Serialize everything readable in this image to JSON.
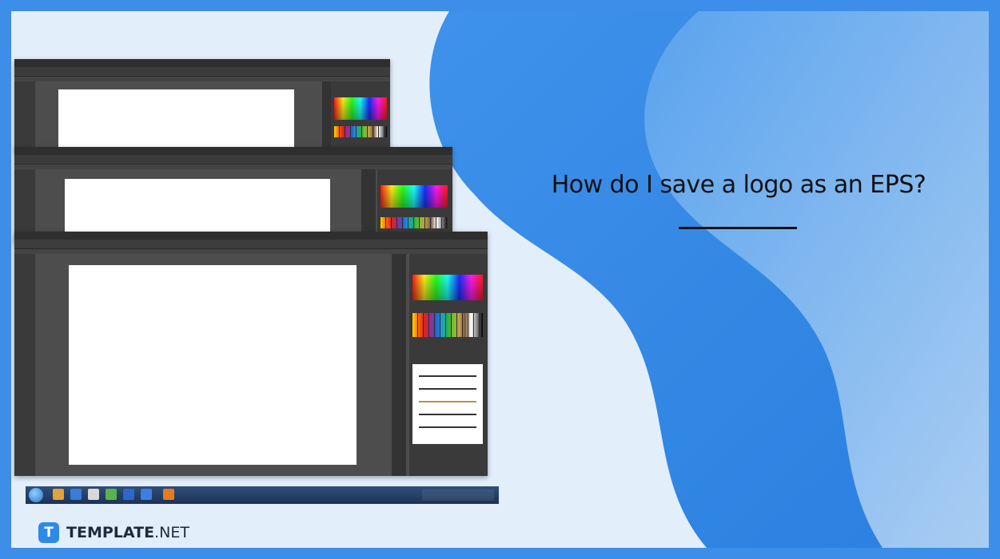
{
  "slide": {
    "title": "How do I save a logo as an EPS?",
    "brand_mark": "T",
    "brand_name_bold": "TEMPLATE",
    "brand_name_light": ".NET"
  },
  "colors": {
    "frame": "#3d8ee8",
    "panel_bg": "#e3eefb",
    "wave_dark": "#3a8ce6",
    "wave_light": "#8cbdf0",
    "title": "#111111",
    "brand_mark": "#2e8ae6",
    "app_bg": "#4d4d4d",
    "app_chrome": "#3a3a3a"
  },
  "screenshot": {
    "description_icons": [
      "illustrator-tools-icon",
      "color-spectrum-icon",
      "swatches-icon",
      "brushes-icon",
      "windows-start-icon"
    ]
  }
}
